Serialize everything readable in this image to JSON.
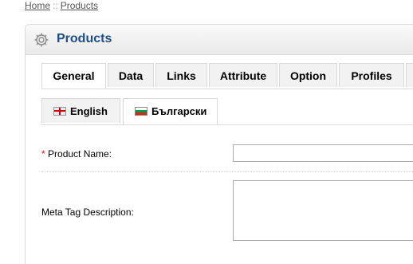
{
  "breadcrumb": {
    "home": "Home",
    "separator": "::",
    "current": "Products"
  },
  "heading": {
    "title": "Products",
    "icon": "gear-icon"
  },
  "tabs": [
    {
      "label": "General",
      "active": true
    },
    {
      "label": "Data"
    },
    {
      "label": "Links"
    },
    {
      "label": "Attribute"
    },
    {
      "label": "Option"
    },
    {
      "label": "Profiles"
    }
  ],
  "languages": [
    {
      "label": "English",
      "flag": "uk-flag-icon"
    },
    {
      "label": "Български",
      "flag": "bg-flag-icon",
      "active": true
    }
  ],
  "form": {
    "required_marker": "*",
    "product_name_label": "Product Name:",
    "product_name_value": "",
    "meta_description_label": "Meta Tag Description:",
    "meta_description_value": ""
  },
  "colors": {
    "heading_text": "#1d4d8a",
    "required": "#ff0000"
  }
}
